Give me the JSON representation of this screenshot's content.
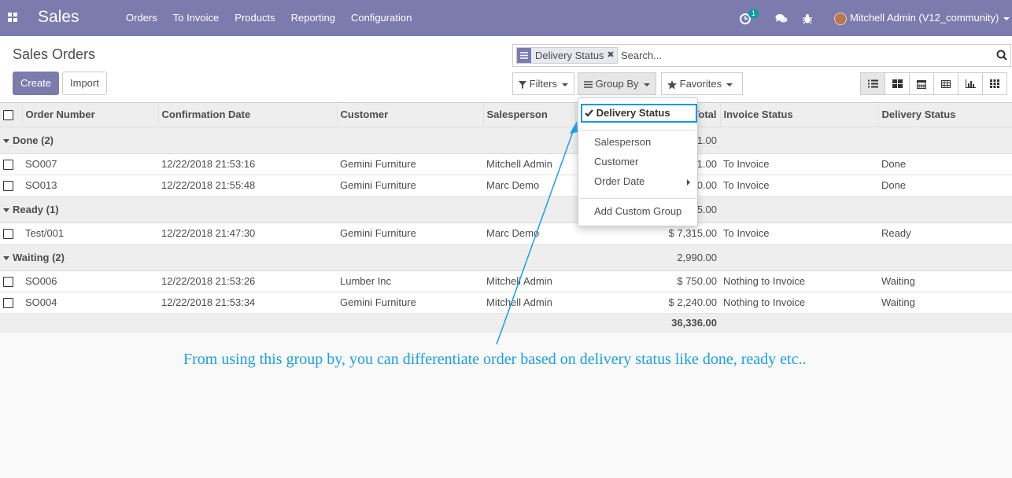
{
  "app": {
    "title": "Sales"
  },
  "topmenu": [
    {
      "label": "Orders"
    },
    {
      "label": "To Invoice"
    },
    {
      "label": "Products"
    },
    {
      "label": "Reporting"
    },
    {
      "label": "Configuration"
    }
  ],
  "systray": {
    "activity_count": "1",
    "user": "Mitchell Admin (V12_community)"
  },
  "page": {
    "title": "Sales Orders",
    "create": "Create",
    "import": "Import"
  },
  "search": {
    "facet": "Delivery Status",
    "placeholder": "Search..."
  },
  "filters": {
    "filters": "Filters",
    "groupby": "Group By",
    "favorites": "Favorites"
  },
  "groupby_menu": {
    "selected": "Delivery Status",
    "items": [
      "Salesperson",
      "Customer",
      "Order Date"
    ],
    "custom": "Add Custom Group"
  },
  "columns": [
    "Order Number",
    "Confirmation Date",
    "Customer",
    "Salesperson",
    "Total",
    "Invoice Status",
    "Delivery Status"
  ],
  "groups": [
    {
      "label": "Done (2)",
      "total": "26,031.00",
      "rows": [
        {
          "order": "SO007",
          "date": "12/22/2018 21:53:16",
          "customer": "Gemini Furniture",
          "salesperson": "Mitchell Admin",
          "total": "$ 24,631.00",
          "invoice": "To Invoice",
          "delivery": "Done"
        },
        {
          "order": "SO013",
          "date": "12/22/2018 21:55:48",
          "customer": "Gemini Furniture",
          "salesperson": "Marc Demo",
          "total": "$ 1,400.00",
          "invoice": "To Invoice",
          "delivery": "Done"
        }
      ]
    },
    {
      "label": "Ready (1)",
      "total": "7,315.00",
      "rows": [
        {
          "order": "Test/001",
          "date": "12/22/2018 21:47:30",
          "customer": "Gemini Furniture",
          "salesperson": "Marc Demo",
          "total": "$ 7,315.00",
          "invoice": "To Invoice",
          "delivery": "Ready"
        }
      ]
    },
    {
      "label": "Waiting (2)",
      "total": "2,990.00",
      "rows": [
        {
          "order": "SO006",
          "date": "12/22/2018 21:53:26",
          "customer": "Lumber Inc",
          "salesperson": "Mitchell Admin",
          "total": "$ 750.00",
          "invoice": "Nothing to Invoice",
          "delivery": "Waiting"
        },
        {
          "order": "SO004",
          "date": "12/22/2018 21:53:34",
          "customer": "Gemini Furniture",
          "salesperson": "Mitchell Admin",
          "total": "$ 2,240.00",
          "invoice": "Nothing to Invoice",
          "delivery": "Waiting"
        }
      ]
    }
  ],
  "grand_total": "36,336.00",
  "annotation": "From using this group by, you can differentiate order based on delivery status like done, ready etc..",
  "colors": {
    "brand": "#7c7bad",
    "annotation": "#1a9fe3",
    "badge": "#00a09d"
  }
}
